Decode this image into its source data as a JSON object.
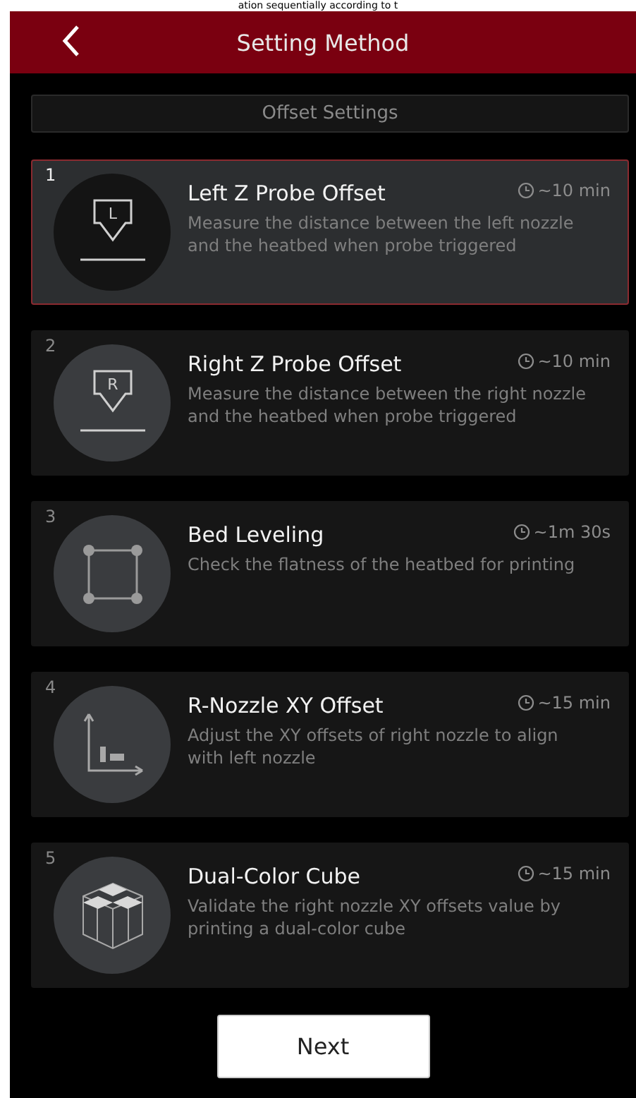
{
  "backdrop_text": "ation sequentially according to t",
  "header": {
    "title": "Setting Method"
  },
  "section": {
    "title": "Offset Settings"
  },
  "methods": [
    {
      "number": "1",
      "kind": "probe",
      "icon_letter": "L",
      "title": "Left Z Probe Offset",
      "time": "~10 min",
      "description": "Measure the distance between the left nozzle and the heatbed when probe triggered",
      "selected": true
    },
    {
      "number": "2",
      "kind": "probe",
      "icon_letter": "R",
      "title": "Right Z Probe Offset",
      "time": "~10 min",
      "description": "Measure the distance between the right nozzle and the heatbed when probe triggered",
      "selected": false
    },
    {
      "number": "3",
      "kind": "grid",
      "title": "Bed Leveling",
      "time": "~1m 30s",
      "description": "Check the flatness of the heatbed for printing",
      "selected": false
    },
    {
      "number": "4",
      "kind": "axes",
      "title": "R-Nozzle XY Offset",
      "time": "~15 min",
      "description": "Adjust the XY offsets of right nozzle to align with left nozzle",
      "selected": false
    },
    {
      "number": "5",
      "kind": "cube",
      "title": "Dual-Color Cube",
      "time": "~15 min",
      "description": "Validate the right nozzle XY offsets value by printing a dual-color cube",
      "selected": false
    }
  ],
  "next_button": "Next"
}
